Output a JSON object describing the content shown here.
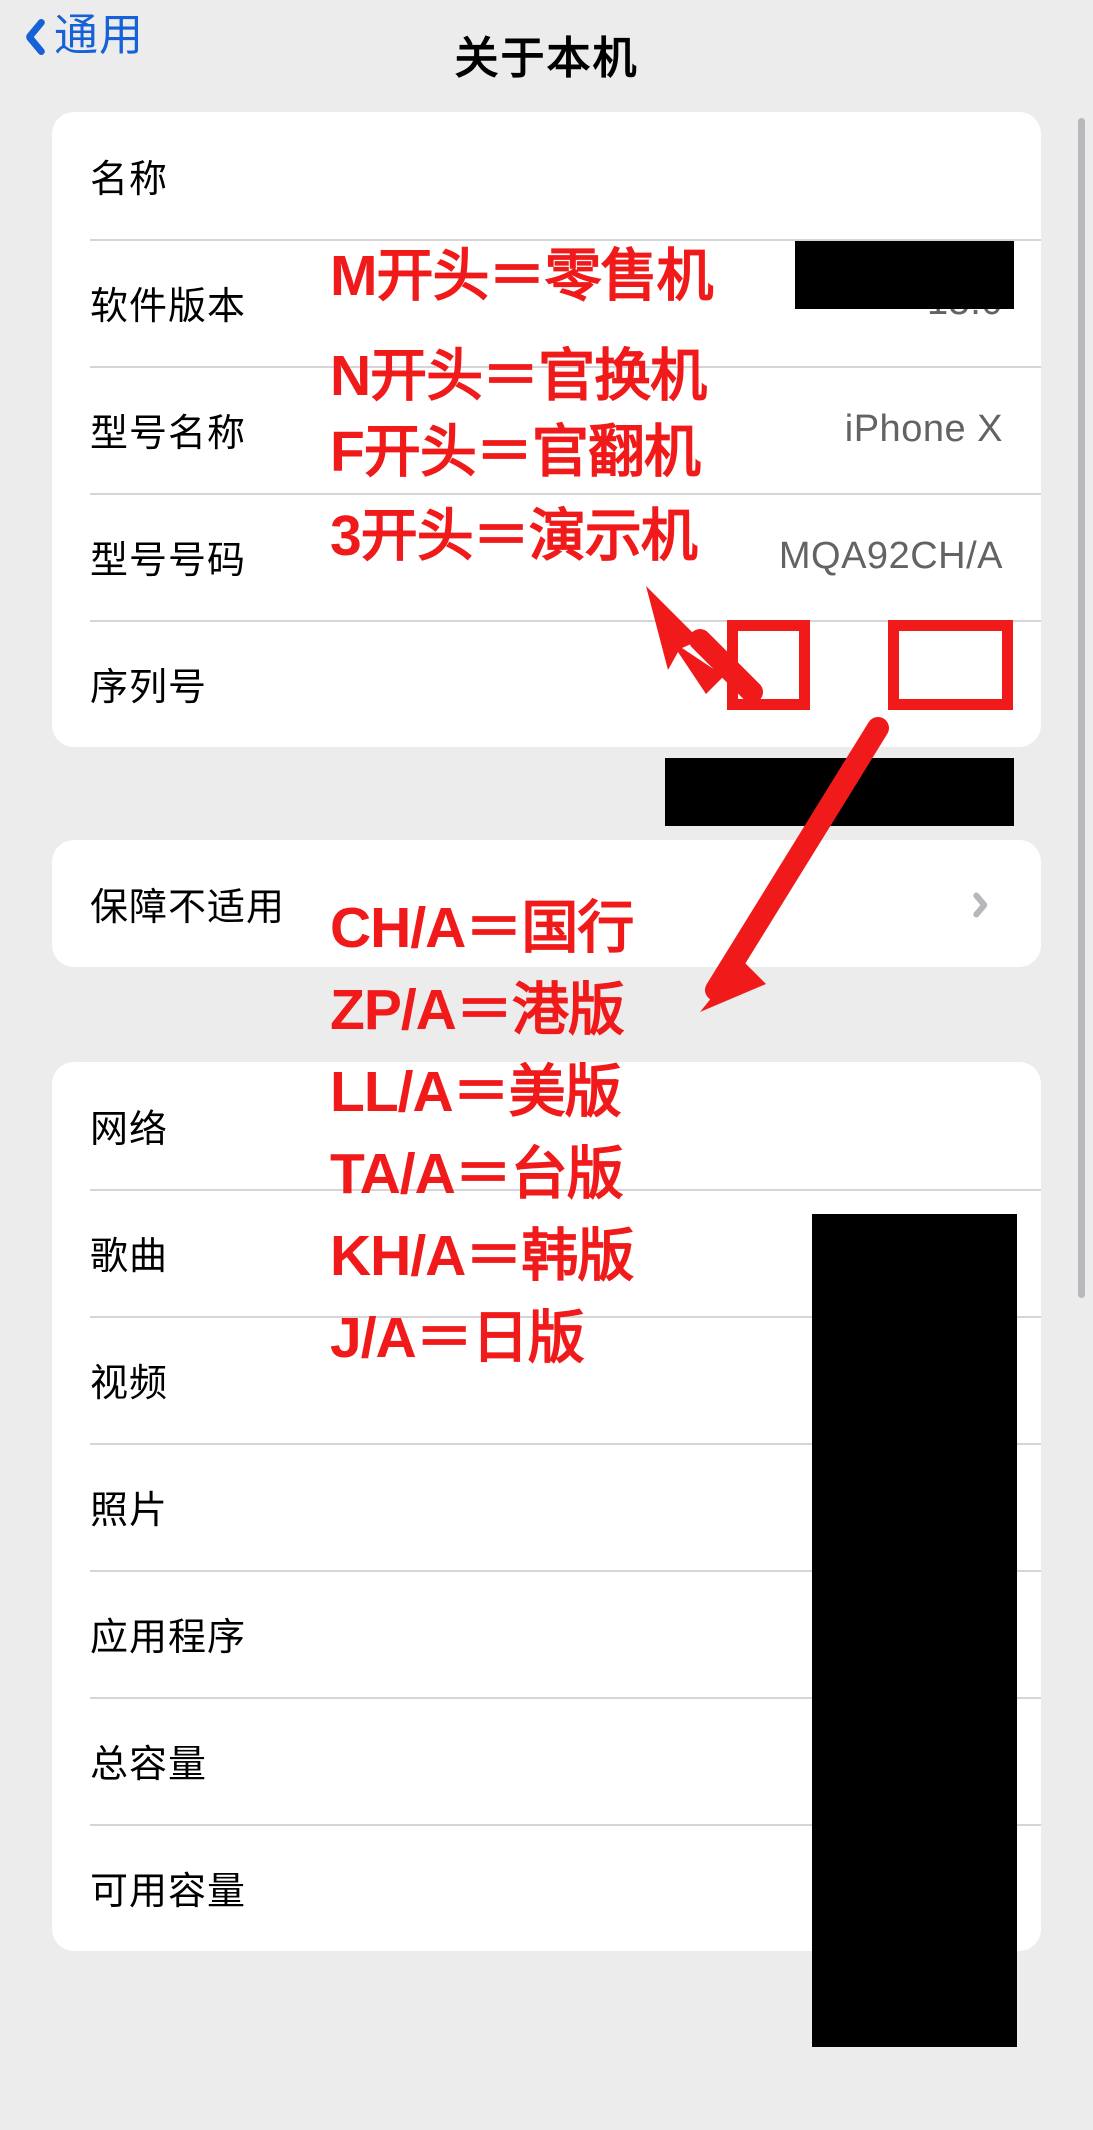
{
  "nav": {
    "back_label": "通用",
    "back_icon": "chevron-left-icon",
    "title": "关于本机"
  },
  "device_card": {
    "rows": [
      {
        "label": "名称",
        "value": "",
        "redacted": true
      },
      {
        "label": "软件版本",
        "value": "15.0",
        "redacted": false
      },
      {
        "label": "型号名称",
        "value": "iPhone X",
        "redacted": false
      },
      {
        "label": "型号号码",
        "value": "MQA92CH/A",
        "redacted": false
      },
      {
        "label": "序列号",
        "value": "",
        "redacted": true
      }
    ]
  },
  "warranty_card": {
    "label": "保障不适用",
    "accessory_icon": "chevron-right-icon"
  },
  "storage_card": {
    "rows": [
      {
        "label": "网络",
        "value": ""
      },
      {
        "label": "歌曲",
        "value": ""
      },
      {
        "label": "视频",
        "value": ""
      },
      {
        "label": "照片",
        "value": ""
      },
      {
        "label": "应用程序",
        "value": ""
      },
      {
        "label": "总容量",
        "value": ""
      },
      {
        "label": "可用容量",
        "value": ""
      }
    ]
  },
  "annotations": {
    "accent_color": "#f01a1a",
    "group_model_prefix": [
      "M开头＝零售机",
      "N开头＝官换机",
      "F开头＝官翻机",
      "3开头＝演示机"
    ],
    "group_region_suffix": [
      "CH/A＝国行",
      "ZP/A＝港版",
      "LL/A＝美版",
      "TA/A＝台版",
      "KH/A＝韩版",
      "J/A＝日版"
    ],
    "highlight_boxes": [
      {
        "name": "model-prefix-highlight"
      },
      {
        "name": "region-suffix-highlight"
      }
    ],
    "arrows": [
      {
        "name": "arrow-to-model-prefix"
      },
      {
        "name": "arrow-to-region-suffix"
      }
    ]
  }
}
